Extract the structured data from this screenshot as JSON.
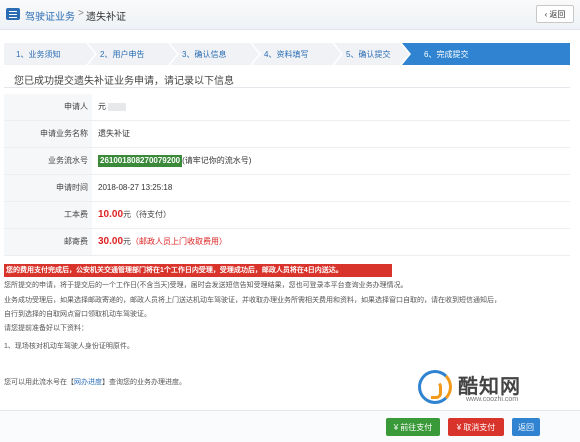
{
  "header": {
    "section": "驾驶证业务",
    "separator": ">",
    "page": "遗失补证",
    "back_label": "返回",
    "back_icon": "chevron-left-icon"
  },
  "steps": [
    {
      "label": "1、业务须知",
      "active": false
    },
    {
      "label": "2、用户申告",
      "active": false
    },
    {
      "label": "3、确认信息",
      "active": false
    },
    {
      "label": "4、资料填写",
      "active": false
    },
    {
      "label": "5、确认提交",
      "active": false
    },
    {
      "label": "6、完成提交",
      "active": true
    }
  ],
  "title": "您已成功提交遗失补证业务申请，请记录以下信息",
  "info": {
    "applicant_label": "申请人",
    "applicant_value": "元",
    "business_label": "申请业务名称",
    "business_value": "遗失补证",
    "serial_label": "业务流水号",
    "serial_value": "261001808270079200",
    "serial_note": "(请牢记你的流水号)",
    "time_label": "申请时间",
    "time_value": "2018-08-27 13:25:18",
    "fee_label": "工本费",
    "fee_value": "10.00",
    "fee_unit": "元（待支付）",
    "postage_label": "邮寄费",
    "postage_value": "30.00",
    "postage_unit": "元",
    "postage_note": "（邮政人员上门收取费用）"
  },
  "notice_highlight": "您的费用支付完成后，公安机关交通管理部门将在1个工作日内受理，受理成功后，邮政人员将在4日内送达。",
  "notes": [
    "您所提交的申请，将于提交后的一个工作日(不含当天)受理，届时会发送短信告知受理结果，您也可登录本平台查询业务办理情况。",
    "业务成功受理后，如果选择邮政寄递的，邮政人员将上门送达机动车驾驶证，并收取办理业务所需相关费用和资料，如果选择窗口自取的，请在收到短信通知后，",
    "自行到选择的自取网点窗口领取机动车驾驶证。",
    "请您提前准备好以下资料：",
    "1、现场核对机动车驾驶人身份证明原件。"
  ],
  "progress_prefix": "您可以用此流水号在【",
  "progress_link": "网办进度",
  "progress_suffix": "】查询您的业务办理进度。",
  "watermark": {
    "name": "酷知网",
    "url": "www.coozhi.com"
  },
  "footer": {
    "pay_label": "前往支付",
    "cancel_label": "取消支付",
    "back_label": "返回"
  },
  "colors": {
    "brand_blue": "#2f83d0",
    "danger_red": "#d9342b",
    "success_green": "#3a9a3a"
  }
}
